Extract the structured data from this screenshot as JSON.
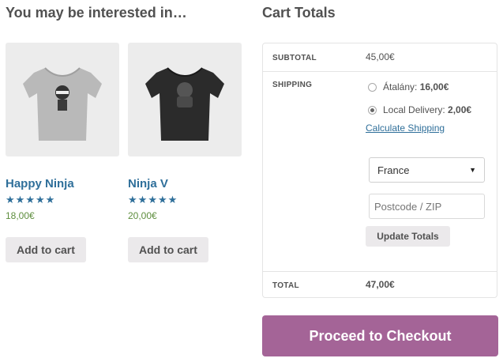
{
  "upsells": {
    "title": "You may be interested in…",
    "products": [
      {
        "name": "Happy Ninja",
        "price": "18,00€",
        "rating": 5,
        "button": "Add to cart",
        "shirt_color": "#b9b9b9"
      },
      {
        "name": "Ninja V",
        "price": "20,00€",
        "rating": 5,
        "button": "Add to cart",
        "shirt_color": "#2b2b2b"
      }
    ]
  },
  "cart_totals": {
    "title": "Cart Totals",
    "subtotal_label": "SUBTOTAL",
    "subtotal_value": "45,00€",
    "shipping_label": "SHIPPING",
    "shipping_options": [
      {
        "name": "Átalány:",
        "price": "16,00€",
        "selected": false
      },
      {
        "name": "Local Delivery:",
        "price": "2,00€",
        "selected": true
      }
    ],
    "calculate_shipping_link": "Calculate Shipping",
    "country_selected": "France",
    "postcode_placeholder": "Postcode / ZIP",
    "update_button": "Update Totals",
    "total_label": "TOTAL",
    "total_value": "47,00€"
  },
  "checkout_button": "Proceed to Checkout",
  "colors": {
    "link": "#2f6f9a",
    "price": "#5e8e3e",
    "checkout": "#a46497",
    "button_bg": "#ebe9eb"
  },
  "icons": {
    "star": "star-icon",
    "dropdown": "chevron-down-icon"
  }
}
